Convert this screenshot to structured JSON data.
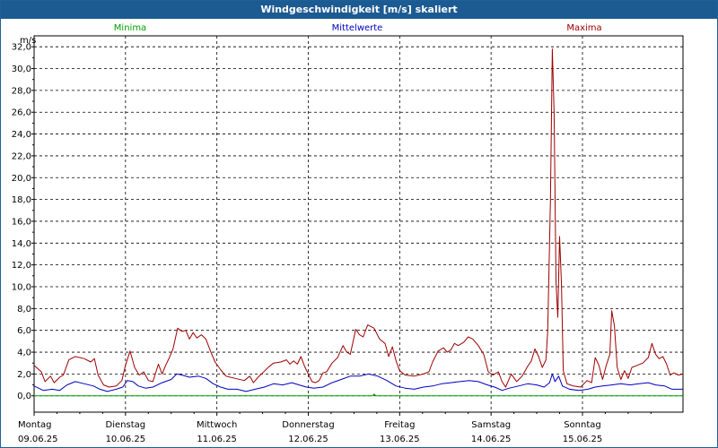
{
  "window": {
    "title": "Windgeschwindigkeit [m/s] skaliert"
  },
  "legend": {
    "min_label": "Minima",
    "mean_label": "Mittelwerte",
    "max_label": "Maxima"
  },
  "chart_data": {
    "type": "line",
    "title": "Windgeschwindigkeit [m/s] skaliert",
    "ylabel": "m/s",
    "xlabel": "",
    "ylim": [
      -1.5,
      33.0
    ],
    "y_ticks": [
      "0,0",
      "2,0",
      "4,0",
      "6,0",
      "8,0",
      "10,0",
      "12,0",
      "14,0",
      "16,0",
      "18,0",
      "20,0",
      "22,0",
      "24,0",
      "26,0",
      "28,0",
      "30,0",
      "32,0"
    ],
    "grid": true,
    "legend_position": "top",
    "x_days": [
      {
        "weekday": "Montag",
        "date": "09.06.25"
      },
      {
        "weekday": "Dienstag",
        "date": "10.06.25"
      },
      {
        "weekday": "Mittwoch",
        "date": "11.06.25"
      },
      {
        "weekday": "Donnerstag",
        "date": "12.06.25"
      },
      {
        "weekday": "Freitag",
        "date": "13.06.25"
      },
      {
        "weekday": "Samstag",
        "date": "14.06.25"
      },
      {
        "weekday": "Sonntag",
        "date": "15.06.25"
      }
    ],
    "x_range_days": [
      0,
      7.1
    ],
    "series": [
      {
        "name": "Maxima",
        "color": "#a00000",
        "points": [
          [
            0,
            2.8
          ],
          [
            0.08,
            2.2
          ],
          [
            0.12,
            1.3
          ],
          [
            0.18,
            1.8
          ],
          [
            0.22,
            1.2
          ],
          [
            0.28,
            1.7
          ],
          [
            0.32,
            1.9
          ],
          [
            0.38,
            3.3
          ],
          [
            0.45,
            3.6
          ],
          [
            0.55,
            3.4
          ],
          [
            0.62,
            3.1
          ],
          [
            0.66,
            3.4
          ],
          [
            0.7,
            1.9
          ],
          [
            0.76,
            1.0
          ],
          [
            0.82,
            0.8
          ],
          [
            0.9,
            0.9
          ],
          [
            0.96,
            1.4
          ],
          [
            1.0,
            2.8
          ],
          [
            1.05,
            4.1
          ],
          [
            1.1,
            2.6
          ],
          [
            1.15,
            1.9
          ],
          [
            1.2,
            2.2
          ],
          [
            1.25,
            1.4
          ],
          [
            1.3,
            1.3
          ],
          [
            1.36,
            2.9
          ],
          [
            1.4,
            2.0
          ],
          [
            1.44,
            2.8
          ],
          [
            1.48,
            3.5
          ],
          [
            1.52,
            4.3
          ],
          [
            1.57,
            6.2
          ],
          [
            1.62,
            5.9
          ],
          [
            1.66,
            6.0
          ],
          [
            1.7,
            5.2
          ],
          [
            1.74,
            5.8
          ],
          [
            1.78,
            5.3
          ],
          [
            1.83,
            5.6
          ],
          [
            1.88,
            5.2
          ],
          [
            1.93,
            4.1
          ],
          [
            1.98,
            3.1
          ],
          [
            2.04,
            2.4
          ],
          [
            2.1,
            1.8
          ],
          [
            2.2,
            1.6
          ],
          [
            2.3,
            1.4
          ],
          [
            2.36,
            1.8
          ],
          [
            2.4,
            1.2
          ],
          [
            2.45,
            1.7
          ],
          [
            2.5,
            2.1
          ],
          [
            2.56,
            2.6
          ],
          [
            2.62,
            3.0
          ],
          [
            2.7,
            3.1
          ],
          [
            2.76,
            3.3
          ],
          [
            2.8,
            2.9
          ],
          [
            2.84,
            3.2
          ],
          [
            2.88,
            2.9
          ],
          [
            2.92,
            3.6
          ],
          [
            2.96,
            2.7
          ],
          [
            3.0,
            2.0
          ],
          [
            3.04,
            1.3
          ],
          [
            3.08,
            1.2
          ],
          [
            3.12,
            1.4
          ],
          [
            3.16,
            2.1
          ],
          [
            3.2,
            2.2
          ],
          [
            3.26,
            3.0
          ],
          [
            3.32,
            3.5
          ],
          [
            3.38,
            4.6
          ],
          [
            3.42,
            4.0
          ],
          [
            3.46,
            3.8
          ],
          [
            3.52,
            6.1
          ],
          [
            3.56,
            5.6
          ],
          [
            3.6,
            5.4
          ],
          [
            3.65,
            6.5
          ],
          [
            3.72,
            6.2
          ],
          [
            3.78,
            5.2
          ],
          [
            3.84,
            4.8
          ],
          [
            3.88,
            3.6
          ],
          [
            3.92,
            4.5
          ],
          [
            3.96,
            3.2
          ],
          [
            4.0,
            2.3
          ],
          [
            4.06,
            1.9
          ],
          [
            4.16,
            1.8
          ],
          [
            4.26,
            2.0
          ],
          [
            4.32,
            2.2
          ],
          [
            4.36,
            3.1
          ],
          [
            4.42,
            4.1
          ],
          [
            4.48,
            4.4
          ],
          [
            4.52,
            4.0
          ],
          [
            4.56,
            4.2
          ],
          [
            4.6,
            4.8
          ],
          [
            4.64,
            4.6
          ],
          [
            4.7,
            4.9
          ],
          [
            4.75,
            5.4
          ],
          [
            4.8,
            5.2
          ],
          [
            4.86,
            4.6
          ],
          [
            4.92,
            3.8
          ],
          [
            4.97,
            2.2
          ],
          [
            5.02,
            1.9
          ],
          [
            5.08,
            2.2
          ],
          [
            5.12,
            1.3
          ],
          [
            5.16,
            0.8
          ],
          [
            5.22,
            2.0
          ],
          [
            5.28,
            1.3
          ],
          [
            5.34,
            1.8
          ],
          [
            5.4,
            2.7
          ],
          [
            5.44,
            3.2
          ],
          [
            5.48,
            4.3
          ],
          [
            5.52,
            3.6
          ],
          [
            5.56,
            2.6
          ],
          [
            5.6,
            3.3
          ],
          [
            5.62,
            6.0
          ],
          [
            5.65,
            17.9
          ],
          [
            5.67,
            31.8
          ],
          [
            5.69,
            25.9
          ],
          [
            5.71,
            10.5
          ],
          [
            5.73,
            7.2
          ],
          [
            5.75,
            14.6
          ],
          [
            5.77,
            10.2
          ],
          [
            5.79,
            2.3
          ],
          [
            5.83,
            1.1
          ],
          [
            5.9,
            0.9
          ],
          [
            5.98,
            0.8
          ],
          [
            6.05,
            1.4
          ],
          [
            6.1,
            1.2
          ],
          [
            6.14,
            3.5
          ],
          [
            6.18,
            2.8
          ],
          [
            6.22,
            1.5
          ],
          [
            6.26,
            2.8
          ],
          [
            6.3,
            3.8
          ],
          [
            6.32,
            7.8
          ],
          [
            6.35,
            6.4
          ],
          [
            6.38,
            2.6
          ],
          [
            6.42,
            1.5
          ],
          [
            6.46,
            2.3
          ],
          [
            6.5,
            1.6
          ],
          [
            6.54,
            2.6
          ],
          [
            6.6,
            2.8
          ],
          [
            6.66,
            3.0
          ],
          [
            6.72,
            3.5
          ],
          [
            6.76,
            4.8
          ],
          [
            6.8,
            3.8
          ],
          [
            6.84,
            3.4
          ],
          [
            6.88,
            3.6
          ],
          [
            6.92,
            2.9
          ],
          [
            6.96,
            1.9
          ],
          [
            7.0,
            2.1
          ],
          [
            7.05,
            1.9
          ],
          [
            7.1,
            2.0
          ]
        ]
      },
      {
        "name": "Mittelwerte",
        "color": "#0000c0",
        "points": [
          [
            0,
            0.9
          ],
          [
            0.1,
            0.5
          ],
          [
            0.2,
            0.6
          ],
          [
            0.28,
            0.5
          ],
          [
            0.36,
            1.0
          ],
          [
            0.45,
            1.3
          ],
          [
            0.55,
            1.1
          ],
          [
            0.65,
            0.9
          ],
          [
            0.72,
            0.6
          ],
          [
            0.8,
            0.4
          ],
          [
            0.9,
            0.6
          ],
          [
            0.97,
            0.8
          ],
          [
            1.02,
            1.4
          ],
          [
            1.08,
            1.3
          ],
          [
            1.14,
            0.9
          ],
          [
            1.22,
            0.7
          ],
          [
            1.3,
            0.8
          ],
          [
            1.4,
            1.2
          ],
          [
            1.5,
            1.5
          ],
          [
            1.56,
            2.0
          ],
          [
            1.62,
            1.9
          ],
          [
            1.7,
            1.7
          ],
          [
            1.8,
            1.8
          ],
          [
            1.88,
            1.6
          ],
          [
            1.96,
            1.1
          ],
          [
            2.04,
            0.8
          ],
          [
            2.12,
            0.6
          ],
          [
            2.22,
            0.6
          ],
          [
            2.32,
            0.4
          ],
          [
            2.42,
            0.6
          ],
          [
            2.52,
            0.8
          ],
          [
            2.62,
            1.1
          ],
          [
            2.72,
            1.0
          ],
          [
            2.82,
            1.2
          ],
          [
            2.9,
            1.0
          ],
          [
            2.98,
            0.8
          ],
          [
            3.06,
            0.7
          ],
          [
            3.16,
            0.8
          ],
          [
            3.26,
            1.2
          ],
          [
            3.36,
            1.5
          ],
          [
            3.46,
            1.8
          ],
          [
            3.56,
            1.8
          ],
          [
            3.66,
            2.0
          ],
          [
            3.76,
            1.8
          ],
          [
            3.86,
            1.4
          ],
          [
            3.96,
            0.9
          ],
          [
            4.06,
            0.7
          ],
          [
            4.16,
            0.6
          ],
          [
            4.26,
            0.8
          ],
          [
            4.36,
            0.9
          ],
          [
            4.46,
            1.1
          ],
          [
            4.56,
            1.2
          ],
          [
            4.66,
            1.3
          ],
          [
            4.76,
            1.4
          ],
          [
            4.86,
            1.3
          ],
          [
            4.96,
            1.0
          ],
          [
            5.04,
            0.8
          ],
          [
            5.12,
            0.5
          ],
          [
            5.2,
            0.7
          ],
          [
            5.3,
            0.9
          ],
          [
            5.4,
            1.1
          ],
          [
            5.5,
            1.0
          ],
          [
            5.58,
            0.8
          ],
          [
            5.64,
            1.2
          ],
          [
            5.67,
            2.0
          ],
          [
            5.7,
            1.3
          ],
          [
            5.74,
            1.8
          ],
          [
            5.78,
            0.9
          ],
          [
            5.86,
            0.6
          ],
          [
            5.96,
            0.5
          ],
          [
            6.06,
            0.6
          ],
          [
            6.14,
            0.8
          ],
          [
            6.22,
            0.9
          ],
          [
            6.32,
            1.0
          ],
          [
            6.42,
            1.1
          ],
          [
            6.52,
            1.0
          ],
          [
            6.62,
            1.1
          ],
          [
            6.72,
            1.2
          ],
          [
            6.8,
            1.0
          ],
          [
            6.9,
            0.9
          ],
          [
            6.98,
            0.6
          ],
          [
            7.1,
            0.6
          ]
        ]
      },
      {
        "name": "Minima",
        "color": "#00a000",
        "points": [
          [
            0,
            0.0
          ],
          [
            3.7,
            0.0
          ],
          [
            3.72,
            0.15
          ],
          [
            3.74,
            0.0
          ],
          [
            7.1,
            0.0
          ]
        ]
      }
    ]
  }
}
